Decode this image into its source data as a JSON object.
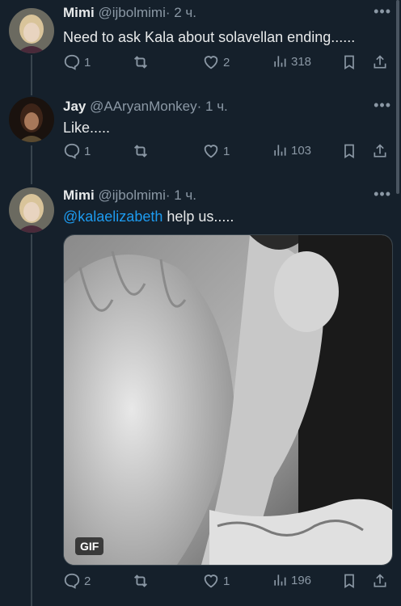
{
  "tweets": [
    {
      "name": "Mimi",
      "handle": "@ijbolmimi",
      "time": "· 2 ч.",
      "text": "Need to ask Kala about solavellan ending......",
      "replies": "1",
      "retweets": "",
      "likes": "2",
      "views": "318"
    },
    {
      "name": "Jay",
      "handle": "@AAryanMonkey",
      "time": "· 1 ч.",
      "text": "Like.....",
      "replies": "1",
      "retweets": "",
      "likes": "1",
      "views": "103"
    },
    {
      "name": "Mimi",
      "handle": "@ijbolmimi",
      "time": "· 1 ч.",
      "mention": "@kalaelizabeth",
      "text": " help us.....",
      "media_badge": "GIF",
      "replies": "2",
      "retweets": "",
      "likes": "1",
      "views": "196"
    }
  ],
  "colors": {
    "background": "#15202b",
    "mention": "#1d9bf0",
    "secondary": "#8b98a5"
  }
}
